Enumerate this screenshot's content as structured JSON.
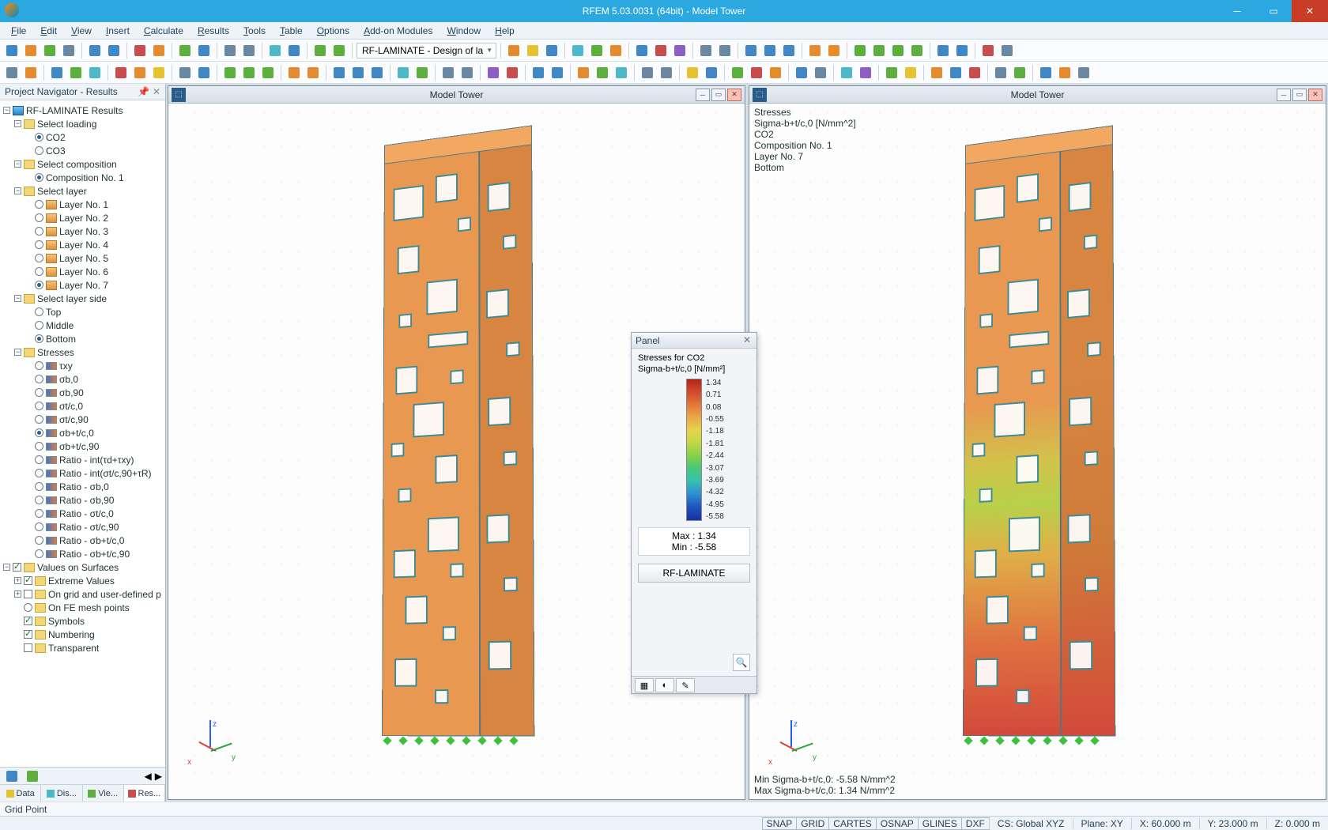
{
  "title": "RFEM 5.03.0031 (64bit) - Model Tower",
  "menu": [
    "File",
    "Edit",
    "View",
    "Insert",
    "Calculate",
    "Results",
    "Tools",
    "Table",
    "Options",
    "Add-on Modules",
    "Window",
    "Help"
  ],
  "toolbar_combo": "RF-LAMINATE - Design of la",
  "navigator": {
    "title": "Project Navigator - Results",
    "root": "RF-LAMINATE Results",
    "loading_hdr": "Select loading",
    "loading_items": [
      {
        "label": "CO2",
        "on": true
      },
      {
        "label": "CO3",
        "on": false
      }
    ],
    "composition_hdr": "Select composition",
    "composition_items": [
      {
        "label": "Composition No. 1",
        "on": true
      }
    ],
    "layer_hdr": "Select layer",
    "layer_items": [
      {
        "label": "Layer No. 1",
        "on": false
      },
      {
        "label": "Layer No. 2",
        "on": false
      },
      {
        "label": "Layer No. 3",
        "on": false
      },
      {
        "label": "Layer No. 4",
        "on": false
      },
      {
        "label": "Layer No. 5",
        "on": false
      },
      {
        "label": "Layer No. 6",
        "on": false
      },
      {
        "label": "Layer No. 7",
        "on": true
      }
    ],
    "side_hdr": "Select layer side",
    "side_items": [
      {
        "label": "Top",
        "on": false
      },
      {
        "label": "Middle",
        "on": false
      },
      {
        "label": "Bottom",
        "on": true
      }
    ],
    "stress_hdr": "Stresses",
    "stress_items": [
      {
        "label": "τxy",
        "on": false
      },
      {
        "label": "σb,0",
        "on": false
      },
      {
        "label": "σb,90",
        "on": false
      },
      {
        "label": "σt/c,0",
        "on": false
      },
      {
        "label": "σt/c,90",
        "on": false
      },
      {
        "label": "σb+t/c,0",
        "on": true
      },
      {
        "label": "σb+t/c,90",
        "on": false
      },
      {
        "label": "Ratio - int(τd+τxy)",
        "on": false
      },
      {
        "label": "Ratio - int(σt/c,90+τR)",
        "on": false
      },
      {
        "label": "Ratio - σb,0",
        "on": false
      },
      {
        "label": "Ratio - σb,90",
        "on": false
      },
      {
        "label": "Ratio - σt/c,0",
        "on": false
      },
      {
        "label": "Ratio - σt/c,90",
        "on": false
      },
      {
        "label": "Ratio - σb+t/c,0",
        "on": false
      },
      {
        "label": "Ratio - σb+t/c,90",
        "on": false
      }
    ],
    "values_hdr": "Values on Surfaces",
    "values_items": [
      {
        "label": "Extreme Values",
        "kind": "node",
        "checked": true
      },
      {
        "label": "On grid and user-defined p",
        "kind": "node",
        "checked": false
      },
      {
        "label": "On FE mesh points",
        "kind": "radio",
        "checked": false
      },
      {
        "label": "Symbols",
        "kind": "check",
        "checked": true
      },
      {
        "label": "Numbering",
        "kind": "check",
        "checked": true
      },
      {
        "label": "Transparent",
        "kind": "check",
        "checked": false
      }
    ],
    "tabs": [
      "Data",
      "Dis...",
      "Vie...",
      "Res..."
    ]
  },
  "viewport": {
    "title": "Model Tower"
  },
  "overlay": {
    "lines": [
      "Stresses",
      "Sigma-b+t/c,0 [N/mm^2]",
      "CO2",
      "Composition No. 1",
      "Layer No. 7",
      "Bottom"
    ],
    "min": "Min Sigma-b+t/c,0: -5.58 N/mm^2",
    "max": "Max Sigma-b+t/c,0: 1.34 N/mm^2"
  },
  "panel": {
    "title": "Panel",
    "sub1": "Stresses for CO2",
    "sub2": "Sigma-b+t/c,0 [N/mm²]",
    "legend": [
      "1.34",
      "0.71",
      "0.08",
      "-0.55",
      "-1.18",
      "-1.81",
      "-2.44",
      "-3.07",
      "-3.69",
      "-4.32",
      "-4.95",
      "-5.58"
    ],
    "max_lbl": "Max  :",
    "max_val": "1.34",
    "min_lbl": "Min  :",
    "min_val": "-5.58",
    "button": "RF-LAMINATE"
  },
  "status": {
    "hint": "Grid Point",
    "toggles": [
      "SNAP",
      "GRID",
      "CARTES",
      "OSNAP",
      "GLINES",
      "DXF"
    ],
    "cs": "CS: Global XYZ",
    "plane": "Plane: XY",
    "x": "X: 60.000 m",
    "y": "Y: 23.000 m",
    "z": "Z: 0.000 m"
  }
}
